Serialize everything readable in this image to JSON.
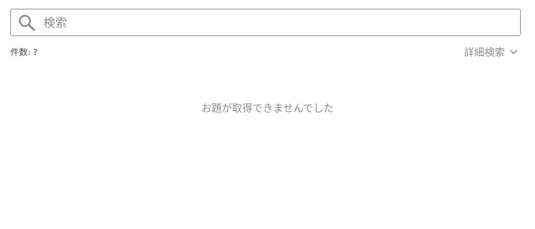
{
  "search": {
    "placeholder": "検索",
    "value": "",
    "icon": "search-icon"
  },
  "result_count": {
    "label": "件数:",
    "value": "?"
  },
  "advanced_search": {
    "label": "詳細検索",
    "icon": "chevron-down-icon"
  },
  "empty_state": {
    "message": "お題が取得できませんでした"
  },
  "colors": {
    "border": "#9a9a9a",
    "muted_text": "#8a8a8a",
    "text": "#444444",
    "background": "#ffffff"
  }
}
